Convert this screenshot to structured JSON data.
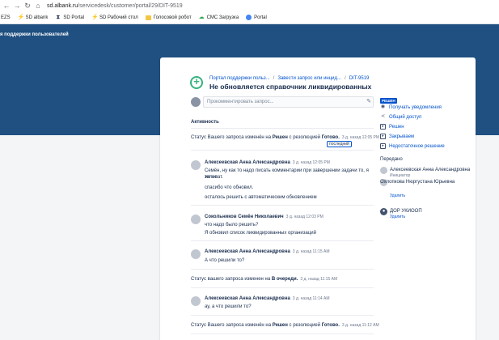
{
  "browser": {
    "url_host": "sd.albank.ru",
    "url_path": "/servicedesk/customer/portal/29/DIT-9519",
    "bookmarks": [
      {
        "label": "EZS",
        "icon": "none"
      },
      {
        "label": "SD albank",
        "icon": "lightning-icon"
      },
      {
        "label": "SD Portal",
        "icon": "hourglass-icon"
      },
      {
        "label": "SD Рабочий стол",
        "icon": "lightning-icon"
      },
      {
        "label": "Голосовой робот",
        "icon": "folder-icon"
      },
      {
        "label": "СМС Загрузка",
        "icon": "cloud-icon"
      },
      {
        "label": "Portal",
        "icon": "globe-icon"
      }
    ]
  },
  "header": {
    "title": "я поддержки пользователей",
    "banner_color": "#205081"
  },
  "request": {
    "breadcrumbs": [
      "Портал поддержки польз...",
      "Завести запрос или инцид...",
      "DIT-9519"
    ],
    "title": "Не обновляется справочник ликвидированных",
    "comment_placeholder": "Прокомментировать запрос..."
  },
  "activity": {
    "heading": "Активность",
    "items": [
      {
        "type": "status",
        "prefix": "Статус Вашего запроса изменён на",
        "status": "Решен",
        "middle": "с резолюцией",
        "resolution": "Готово.",
        "time": "3 д. назад 12:05 PM",
        "badge": "последний"
      },
      {
        "type": "comment",
        "author": "Алексеевская Анна Александровна",
        "time": "3 д. назад 12:05 PM",
        "lines": [
          "Семён, ну как то надо писать комментарии при завершении задачи то, я же не",
          "телепат.",
          "спасибо что обновил.",
          "осталось решить с автоматическим обновлением"
        ]
      },
      {
        "type": "comment",
        "author": "Сокольников Семён Николаевич",
        "time": "3 д. назад 12:03 PM",
        "lines": [
          "что надо было решить?",
          "Я обновил список ликвидированных организаций"
        ]
      },
      {
        "type": "comment",
        "author": "Алексеевская Анна Александровна",
        "time": "3 д. назад 11:15 AM",
        "lines": [
          "А что решили то?"
        ]
      },
      {
        "type": "status",
        "prefix": "Статус вашего запроса изменен на",
        "status": "В очереди.",
        "time": "3 д. назад 11:15 AM"
      },
      {
        "type": "comment",
        "author": "Алексеевская Анна Александровна",
        "time": "3 д. назад 11:14 AM",
        "lines": [
          "ау, а что решили то?"
        ]
      },
      {
        "type": "status",
        "prefix": "Статус Вашего запроса изменён на",
        "status": "Решен",
        "middle": "с резолюцией",
        "resolution": "Готово.",
        "time": "3 д. назад 11:12 AM"
      }
    ]
  },
  "sidebar": {
    "status": "РЕШЕН",
    "actions": [
      {
        "label": "Получать уведомления",
        "icon": "eye-icon"
      },
      {
        "label": "Общий доступ",
        "icon": "share-icon"
      },
      {
        "label": "Решен",
        "icon": "checkbox-icon"
      },
      {
        "label": "Закрываем",
        "icon": "checkbox-icon"
      },
      {
        "label": "Недостаточное решение",
        "icon": "checkbox-icon"
      }
    ],
    "shared_heading": "Передано",
    "people": [
      {
        "name": "Алексеевская Анна Александровна",
        "role": "Инициатор"
      },
      {
        "name": "Охлопкова Нюргустана Юрьевна",
        "delete": "Удалить"
      },
      {
        "name": "ДОР УКИООП",
        "delete": "Удалить"
      }
    ]
  }
}
